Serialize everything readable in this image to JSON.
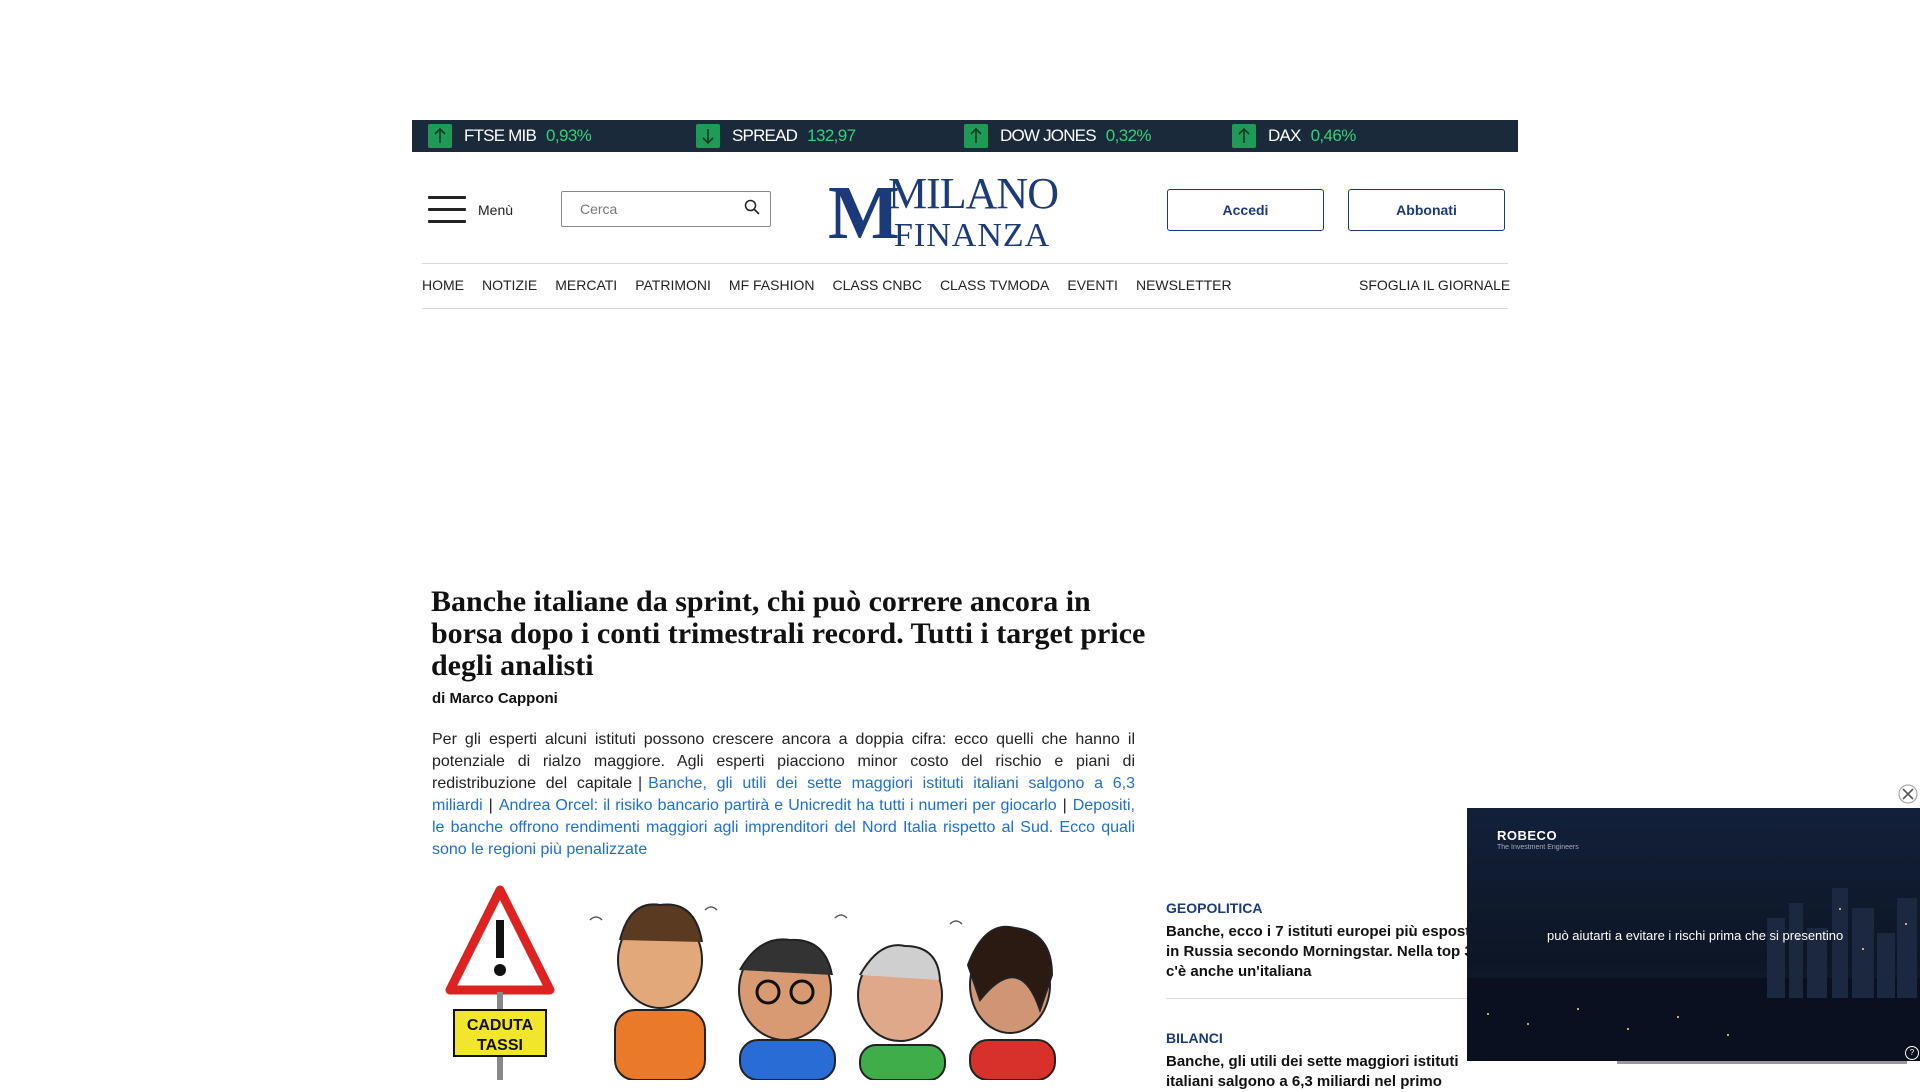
{
  "ticker": [
    {
      "name": "FTSE MIB",
      "value": "0,93%",
      "direction": "up"
    },
    {
      "name": "SPREAD",
      "value": "132,97",
      "direction": "down"
    },
    {
      "name": "DOW JONES",
      "value": "0,32%",
      "direction": "up"
    },
    {
      "name": "DAX",
      "value": "0,46%",
      "direction": "up"
    }
  ],
  "header": {
    "menu_label": "Menù",
    "search_placeholder": "Cerca",
    "logo_line1": "MILANO",
    "logo_line2": "FINANZA",
    "login_label": "Accedi",
    "subscribe_label": "Abbonati"
  },
  "nav": {
    "items": [
      "HOME",
      "NOTIZIE",
      "MERCATI",
      "PATRIMONI",
      "MF FASHION",
      "CLASS CNBC",
      "CLASS TVMODA",
      "EVENTI",
      "NEWSLETTER"
    ],
    "right": "SFOGLIA IL GIORNALE"
  },
  "article": {
    "title": "Banche italiane da sprint, chi può correre ancora in borsa dopo i conti trimestrali record. Tutti i target price degli analisti",
    "byline": "di Marco Capponi",
    "lead": "Per gli esperti alcuni istituti possono crescere ancora a doppia cifra: ecco quelli che hanno il potenziale di rialzo maggiore. Agli esperti piacciono minor costo del rischio e piani di redistribuzione del capitale",
    "links": [
      "Banche, gli utili dei sette maggiori istituti italiani salgono a 6,3 miliardi",
      "Andrea Orcel: il risiko bancario partirà e Unicredit ha tutti i numeri per giocarlo",
      "Depositi, le banche offrono rendimenti maggiori agli imprenditori del Nord Italia rispetto al Sud. Ecco quali sono le regioni più penalizzate"
    ],
    "cartoon_sign_line1": "CADUTA",
    "cartoon_sign_line2": "TASSI"
  },
  "sidebar": [
    {
      "category": "GEOPOLITICA",
      "title": "Banche, ecco i 7 istituti europei più esposti in Russia secondo Morningstar. Nella top 3 c'è anche un'italiana"
    },
    {
      "category": "BILANCI",
      "title": "Banche, gli utili dei sette maggiori istituti italiani salgono a 6,3 miliardi nel primo"
    }
  ],
  "video": {
    "brand": "ROBECO",
    "brand_sub": "The Investment Engineers",
    "caption": "può aiutarti a evitare i rischi prima che si presentino"
  },
  "colors": {
    "brand": "#1b3a7a",
    "ticker_bg": "#1b2a3a",
    "up": "#33d17a",
    "link": "#1d6fd0"
  }
}
